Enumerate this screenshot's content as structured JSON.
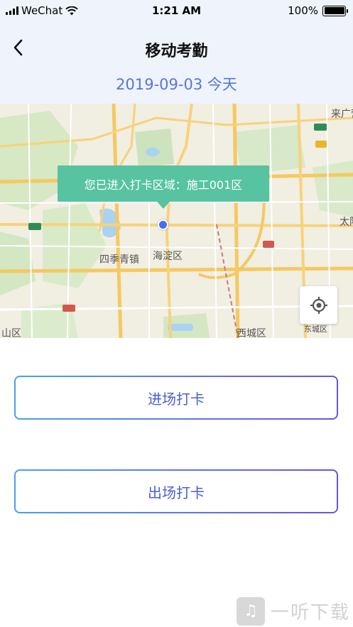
{
  "status_bar": {
    "carrier": "WeChat",
    "time": "1:21 AM",
    "battery": "100%"
  },
  "header": {
    "title": "移动考勤",
    "date": "2019-09-03 今天"
  },
  "map": {
    "tooltip": "您已进入打卡区域：施工001区",
    "labels": {
      "haidian": "海淀区",
      "sijiqing": "四季青镇",
      "xicheng": "西城区",
      "dongcheng": "东城区",
      "shanqu": "山区",
      "taiyang": "太阳",
      "laiguang": "来广营"
    }
  },
  "actions": {
    "enter_label": "进场打卡",
    "exit_label": "出场打卡"
  },
  "watermark": {
    "text": "一听下载"
  }
}
